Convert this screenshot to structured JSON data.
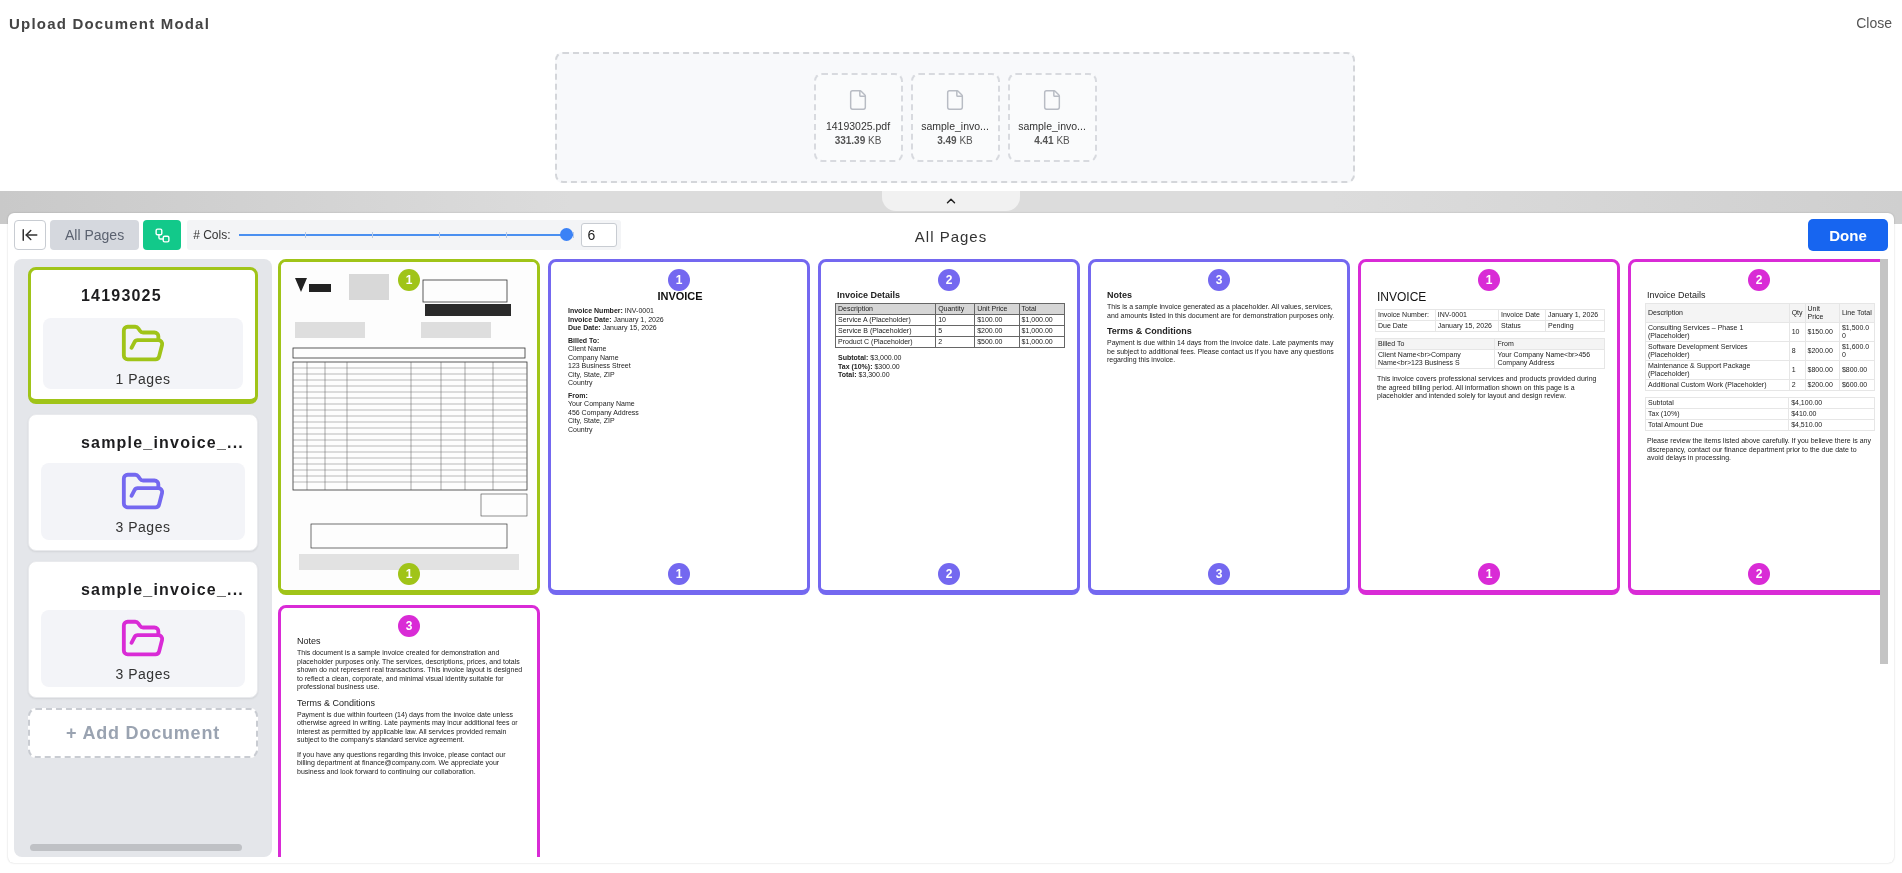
{
  "header": {
    "title": "Upload Document Modal",
    "close": "Close"
  },
  "files": [
    {
      "name": "14193025.pdf",
      "size": "**331.39** KB"
    },
    {
      "name": "sample_invo...",
      "size": "**3.49** KB"
    },
    {
      "name": "sample_invo...",
      "size": "**4.41** KB"
    }
  ],
  "toolbar": {
    "view_modes": [
      {
        "kind": "text",
        "label": "All Pages",
        "selected": false
      },
      {
        "kind": "icon",
        "selected": true
      }
    ],
    "columns": {
      "label": "# Cols:",
      "value": "6",
      "level": 1
    },
    "title": "All Pages",
    "done": "Done"
  },
  "documents": [
    {
      "name": "14193025",
      "pages": "1 Pages",
      "color": "#a0c418",
      "selected": true
    },
    {
      "name": "sample_invoice_...",
      "pages": "3 Pages",
      "color": "#7468f0",
      "selected": false
    },
    {
      "name": "sample_invoice_...",
      "pages": "3 Pages",
      "color": "#d92bd6",
      "selected": false
    }
  ],
  "add_document": "+ Add Document",
  "pages": [
    {
      "number": "1",
      "footer_number": "1",
      "color": "#a0c418",
      "kind": "scanned"
    },
    {
      "number": "1",
      "footer_number": "1",
      "color": "#7468f0",
      "kind": "simple",
      "blocks": [
        {
          "kind": "title",
          "text": "INVOICE"
        },
        {
          "kind": "lines",
          "lines": [
            "**Invoice Number:** INV-0001",
            "**Invoice Date:** January 1, 2026",
            "**Due Date:** January 15, 2026"
          ]
        },
        {
          "kind": "lines",
          "lines": [
            "**Billed To:**",
            "Client Name",
            "Company Name",
            "123 Business Street",
            "City, State, ZIP",
            "Country"
          ]
        },
        {
          "kind": "lines",
          "lines": [
            "**From:**",
            "Your Company Name",
            "456 Company Address",
            "City, State, ZIP",
            "Country"
          ]
        }
      ]
    },
    {
      "number": "2",
      "footer_number": "2",
      "color": "#7468f0",
      "kind": "simple",
      "blocks": [
        {
          "kind": "heading",
          "text": "Invoice Details"
        },
        {
          "kind": "table",
          "columns": [
            "Description",
            "Quantity",
            "Unit Price",
            "Total"
          ],
          "rows": [
            [
              "Service A (Placeholder)",
              "10",
              "$100.00",
              "$1,000.00"
            ],
            [
              "Service B (Placeholder)",
              "5",
              "$200.00",
              "$1,000.00"
            ],
            [
              "Product C (Placeholder)",
              "2",
              "$500.00",
              "$1,000.00"
            ]
          ]
        },
        {
          "kind": "lines",
          "lines": [
            "**Subtotal:** $3,000.00",
            "**Tax (10%):** $300.00",
            "**Total:** $3,300.00"
          ]
        }
      ]
    },
    {
      "number": "3",
      "footer_number": "3",
      "color": "#7468f0",
      "kind": "simple",
      "blocks": [
        {
          "kind": "heading",
          "text": "Notes"
        },
        {
          "kind": "paragraph",
          "text": "This is a sample invoice generated as a placeholder. All values, services, and amounts listed in this document are for demonstration purposes only."
        },
        {
          "kind": "heading",
          "text": "Terms & Conditions"
        },
        {
          "kind": "paragraph",
          "text": "Payment is due within 14 days from the invoice date. Late payments may be subject to additional fees. Please contact us if you have any questions regarding this invoice."
        }
      ]
    },
    {
      "number": "1",
      "footer_number": "1",
      "color": "#d92bd6",
      "kind": "styled",
      "blocks": [
        {
          "kind": "title",
          "text": "INVOICE"
        },
        {
          "kind": "table",
          "rows": [
            [
              "Invoice Number:",
              "INV-0001",
              "Invoice Date",
              "January 1, 2026"
            ],
            [
              "Due Date",
              "January 15, 2026",
              "Status",
              "Pending"
            ]
          ]
        },
        {
          "kind": "table",
          "columns": [
            "Billed To",
            "From"
          ],
          "rows": [
            [
              "Client Name<br>Company Name<br>123 Business S",
              "Your Company Name<br>456 Company Address"
            ]
          ]
        },
        {
          "kind": "paragraph",
          "text": "This invoice covers professional services and products provided during the agreed billing period. All information shown on this page is a placeholder and intended solely for layout and design review."
        }
      ]
    },
    {
      "number": "2",
      "footer_number": "2",
      "color": "#d92bd6",
      "kind": "styled",
      "blocks": [
        {
          "kind": "heading",
          "text": "Invoice Details"
        },
        {
          "kind": "table",
          "columns": [
            "Description",
            "Qty",
            "Unit Price",
            "Line Total"
          ],
          "rows": [
            [
              "Consulting Services – Phase 1 (Placeholder)",
              "10",
              "$150.00",
              "$1,500.00"
            ],
            [
              "Software Development Services (Placeholder)",
              "8",
              "$200.00",
              "$1,600.00"
            ],
            [
              "Maintenance & Support Package (Placeholder)",
              "1",
              "$800.00",
              "$800.00"
            ],
            [
              "Additional Custom Work (Placeholder)",
              "2",
              "$200.00",
              "$600.00"
            ]
          ]
        },
        {
          "kind": "table",
          "rows": [
            [
              "Subtotal",
              "$4,100.00"
            ],
            [
              "Tax (10%)",
              "$410.00"
            ],
            [
              "Total Amount Due",
              "$4,510.00"
            ]
          ]
        },
        {
          "kind": "paragraph",
          "text": "Please review the items listed above carefully. If you believe there is any discrepancy, contact our finance department prior to the due date to avoid delays in processing."
        }
      ]
    },
    {
      "number": "3",
      "color": "#d92bd6",
      "kind": "styled",
      "blocks": [
        {
          "kind": "heading",
          "text": "Notes"
        },
        {
          "kind": "paragraph",
          "text": "This document is a sample invoice created for demonstration and placeholder purposes only. The services, descriptions, prices, and totals shown do not represent real transactions. This invoice layout is designed to reflect a clean, corporate, and minimal visual identity suitable for professional business use."
        },
        {
          "kind": "heading",
          "text": "Terms & Conditions"
        },
        {
          "kind": "paragraph",
          "text": "Payment is due within fourteen (14) days from the invoice date unless otherwise agreed in writing. Late payments may incur additional fees or interest as permitted by applicable law. All services provided remain subject to the company's standard service agreement."
        },
        {
          "kind": "paragraph",
          "text": "If you have any questions regarding this invoice, please contact our billing department at finance@company.com. We appreciate your business and look forward to continuing our collaboration."
        }
      ]
    }
  ]
}
